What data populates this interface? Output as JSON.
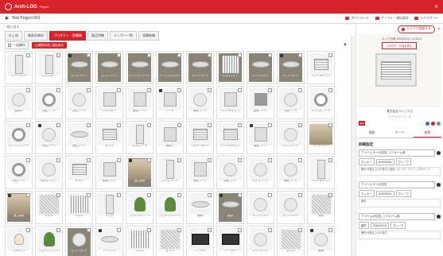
{
  "app": {
    "name": "Arch-LOG",
    "sub": "Project"
  },
  "project": {
    "name": "Test Project 001",
    "actions": [
      "ダウンロード",
      "サンプル・資料請求",
      "エクスポート"
    ]
  },
  "back": "前に戻る",
  "tabs": [
    {
      "label": "仕上材"
    },
    {
      "label": "建具金物材"
    },
    {
      "label": "プロダクト・設備機",
      "active": true
    },
    {
      "label": "製品特集"
    },
    {
      "label": "メーカー一覧"
    },
    {
      "label": "見積依頼"
    }
  ],
  "toolbar": {
    "select_all": "一括操作",
    "filter_chip": "仕様書作成に追加済み"
  },
  "panel": {
    "reg_button": "シックで登録する",
    "date": "ロック日時 2023/03/31 10:30:21",
    "img_button": "カタログ・写真を見る",
    "maker": "株式会社ユニックス",
    "maker_sub": "エアベントシリーズ",
    "tabs": [
      "情報",
      "ボード",
      "使用"
    ],
    "section": "詳細設定",
    "entries": [
      {
        "name": "ファームラーの住宅_リフォーム用",
        "sel1": "ラッキー",
        "sel2": "2023/03/31",
        "sel3": "グレープ",
        "note": "備考 外壁仕上げの検討に使用 リビング・ダイニングのベント"
      },
      {
        "name": "ファームラーの住宅",
        "sel1": "ラッキー",
        "sel2": "2023/03/31",
        "sel3": "グレープ",
        "note": "備考"
      },
      {
        "name": "ファームの住宅_リフォーム用",
        "sel1": "屋外",
        "sel2": "2024/02/15",
        "sel3": "グレープ",
        "note": "備考 外壁仕上げの検討"
      }
    ]
  },
  "grid": [
    {
      "shape": "tall",
      "cap": "エアーベント"
    },
    {
      "shape": "tall",
      "cap": "レジスター"
    },
    {
      "shape": "disc",
      "cap": "ダウンライト",
      "dark": true
    },
    {
      "shape": "disc",
      "cap": "ダウンライト",
      "dark": true
    },
    {
      "shape": "disc",
      "cap": "シーリングライト",
      "dark": true
    },
    {
      "shape": "disc",
      "cap": "シーリングライト",
      "dark": true
    },
    {
      "shape": "disc",
      "cap": "ダウンライト",
      "dark": true
    },
    {
      "shape": "mesh",
      "cap": "パネルライト",
      "dark": true
    },
    {
      "shape": "disc",
      "cap": "ダウンライト",
      "dark": true
    },
    {
      "shape": "disc",
      "cap": "ダウンライト",
      "dark": true
    },
    {
      "shape": "vent",
      "cap": "ベントキャップ"
    },
    {
      "shape": "round",
      "cap": "換気口"
    },
    {
      "shape": "ring",
      "cap": "丸型フード"
    },
    {
      "shape": "round",
      "cap": "丸型フード"
    },
    {
      "shape": "square",
      "cap": "レジスター"
    },
    {
      "shape": "square",
      "cap": "角型フード"
    },
    {
      "shape": "square",
      "cap": "フード"
    },
    {
      "shape": "round",
      "cap": "換気フード"
    },
    {
      "shape": "square",
      "cap": "ベントキャップ"
    },
    {
      "shape": "box",
      "cap": "換気フード"
    },
    {
      "shape": "round",
      "cap": "丸型フード"
    },
    {
      "shape": "ring",
      "cap": "シンプルフード"
    },
    {
      "shape": "ring",
      "cap": "ステンレスフード"
    },
    {
      "shape": "round",
      "cap": "丸型フード"
    },
    {
      "shape": "disc",
      "cap": "深型フード"
    },
    {
      "shape": "vent",
      "cap": "ガラリ"
    },
    {
      "shape": "tall",
      "cap": "スリムフード"
    },
    {
      "shape": "square",
      "cap": "換気口"
    },
    {
      "shape": "vent",
      "cap": "ウェザーカバー"
    },
    {
      "shape": "vent",
      "cap": "ベンドキャップ"
    },
    {
      "shape": "square",
      "cap": "換気フード"
    },
    {
      "shape": "round",
      "cap": "パイプフード"
    },
    {
      "shape": "room",
      "cap": "エントランス"
    },
    {
      "shape": "ring",
      "cap": "丸型フード"
    },
    {
      "shape": "round",
      "cap": "防火ダンパー"
    },
    {
      "shape": "vent",
      "cap": "ガラリ"
    },
    {
      "shape": "square",
      "cap": "換気フード"
    },
    {
      "shape": "room",
      "cap": "施工事例",
      "dark": true
    },
    {
      "shape": "tall",
      "cap": "スリムフード"
    },
    {
      "shape": "square",
      "cap": "深型フード"
    },
    {
      "shape": "round",
      "cap": "丸型フード"
    },
    {
      "shape": "round",
      "cap": "パイプフード"
    },
    {
      "shape": "round",
      "cap": "換気フード"
    },
    {
      "shape": "tall",
      "cap": "ベントキャップ"
    },
    {
      "shape": "room",
      "cap": "施工事例",
      "dark": true
    },
    {
      "shape": "tile",
      "cap": "タイル"
    },
    {
      "shape": "mesh",
      "cap": "パネル"
    },
    {
      "shape": "tall",
      "cap": "スリム"
    },
    {
      "shape": "tree",
      "cap": "フェイクグリーン"
    },
    {
      "shape": "tree",
      "cap": "フェイクグリーン"
    },
    {
      "shape": "disc",
      "cap": "照明"
    },
    {
      "shape": "disc",
      "cap": "照明",
      "dark": true
    },
    {
      "shape": "round",
      "cap": "ダウンライト"
    },
    {
      "shape": "round",
      "cap": "ダウンライト"
    },
    {
      "shape": "tile",
      "cap": "床材"
    },
    {
      "shape": "bulb",
      "cap": "ブラケット"
    },
    {
      "shape": "tree",
      "cap": "フェイクグリーン"
    },
    {
      "shape": "round",
      "cap": "ダウンライト",
      "dark": true
    },
    {
      "shape": "disc",
      "cap": "シーリング"
    },
    {
      "shape": "mesh",
      "cap": "パネル"
    },
    {
      "shape": "tile",
      "cap": "タイル"
    },
    {
      "shape": "laptop",
      "cap": "ノートPC"
    },
    {
      "shape": "laptop",
      "cap": "ノートPC"
    },
    {
      "shape": "round",
      "cap": "ダウンライト"
    },
    {
      "shape": "tile",
      "cap": "タイル"
    },
    {
      "shape": "round",
      "cap": "照明"
    }
  ]
}
